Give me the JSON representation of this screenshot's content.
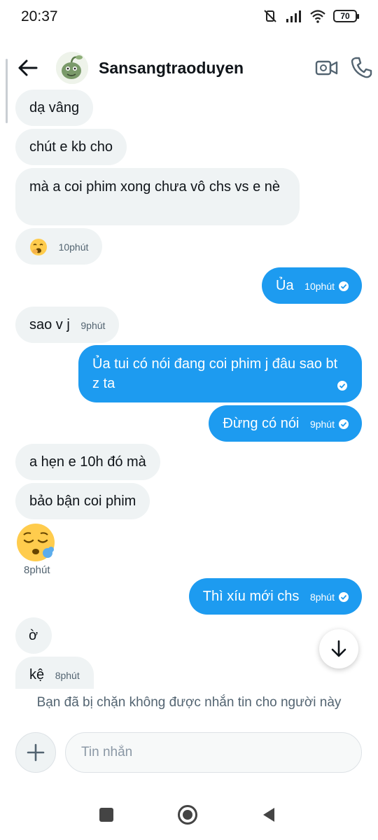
{
  "status_bar": {
    "time": "20:37",
    "battery": "70",
    "icons": [
      "mute-icon",
      "signal-icon",
      "wifi-icon",
      "battery-icon"
    ]
  },
  "header": {
    "contact_name": "Sansangtraoduyen",
    "icons": [
      "back-arrow-icon",
      "video-call-icon",
      "phone-icon"
    ]
  },
  "messages": [
    {
      "side": "in",
      "text": "dạ vâng",
      "time": ""
    },
    {
      "side": "in",
      "text": "chút e kb cho",
      "time": ""
    },
    {
      "side": "in",
      "text": "mà a coi phim xong chưa vô chs vs e nè",
      "time": ""
    },
    {
      "side": "in",
      "emoji": "yawning-face",
      "time": "10phút"
    },
    {
      "side": "out",
      "text": "Ủa",
      "time": "10phút",
      "seen": true
    },
    {
      "side": "in",
      "text": "sao v j",
      "time": "9phút"
    },
    {
      "side": "out",
      "text": "Ủa tui có nói đang coi phim j đâu sao bt z ta",
      "time": "",
      "seen": true
    },
    {
      "side": "out",
      "text": "Đừng có nói",
      "time": "9phút",
      "seen": true
    },
    {
      "side": "in",
      "text": "a hẹn e 10h đó mà",
      "time": ""
    },
    {
      "side": "in",
      "text": "bảo bận coi phim",
      "time": ""
    },
    {
      "side": "in",
      "emoji": "sleepy-face",
      "time": "8phút"
    },
    {
      "side": "out",
      "text": "Thì xíu mới chs",
      "time": "8phút",
      "seen": true
    },
    {
      "side": "in",
      "text": "ờ",
      "time": ""
    },
    {
      "side": "in",
      "text": "kệ",
      "time": "8phút"
    }
  ],
  "blocked_notice": "Bạn đã bị chặn không được nhắn tin cho người này",
  "composer": {
    "placeholder": "Tin nhắn",
    "value": ""
  },
  "colors": {
    "outgoing_bubble": "#1d9bf0",
    "incoming_bubble": "#eff3f4",
    "muted_text": "#536471"
  }
}
